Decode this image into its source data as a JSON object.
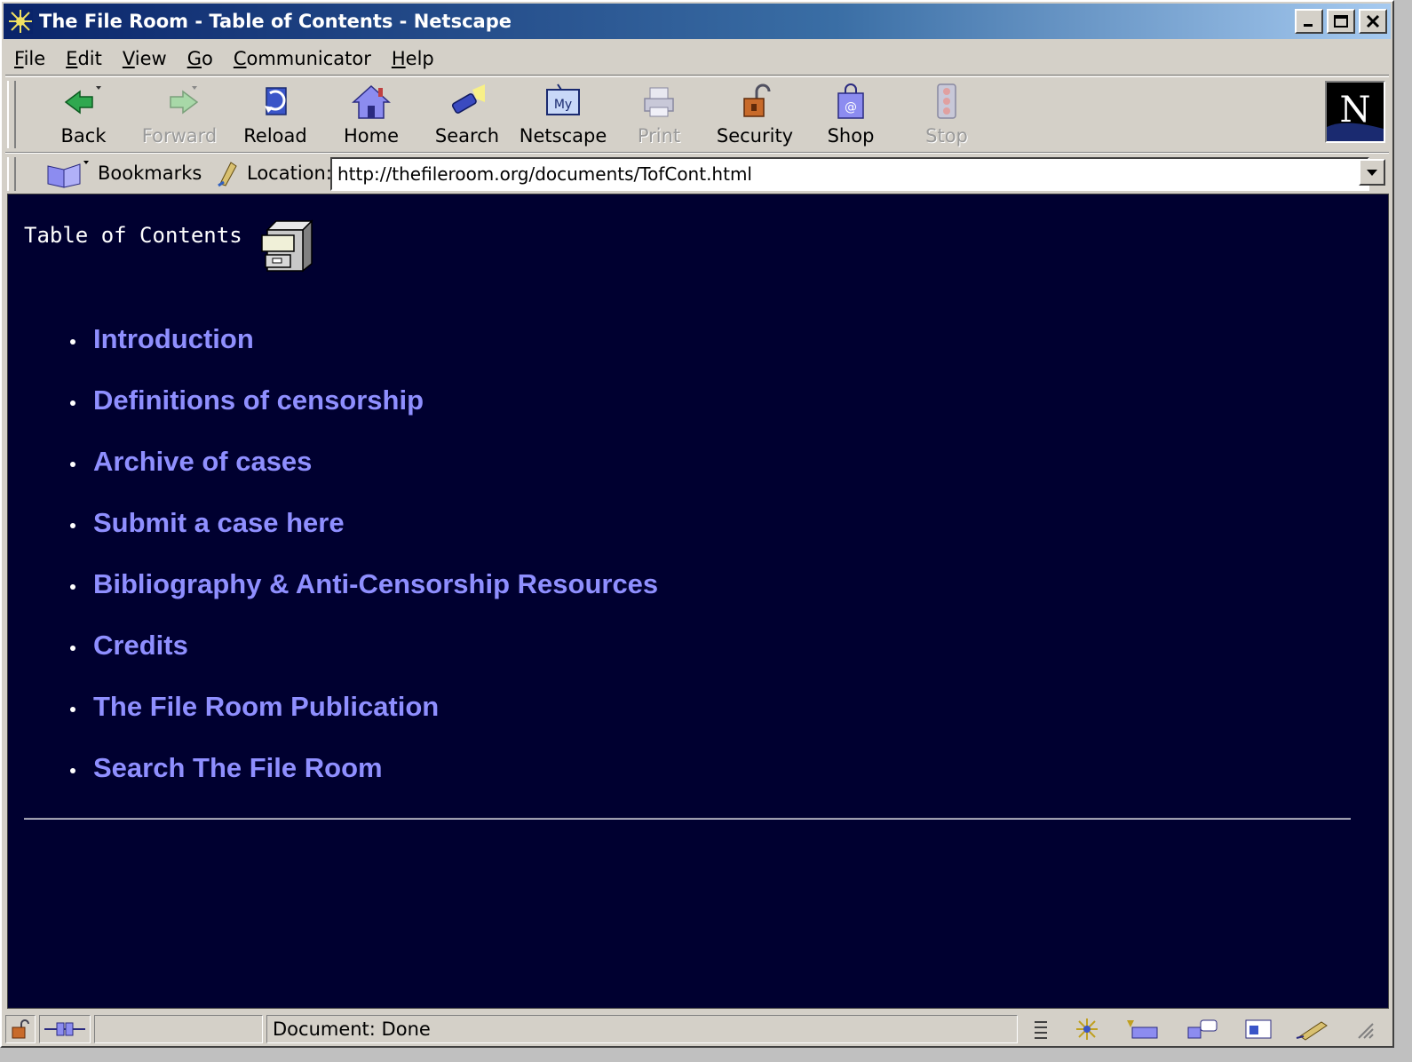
{
  "window": {
    "title": "The File Room - Table of Contents - Netscape"
  },
  "menubar": {
    "items": [
      {
        "accel": "F",
        "rest": "ile"
      },
      {
        "accel": "E",
        "rest": "dit"
      },
      {
        "accel": "V",
        "rest": "iew"
      },
      {
        "accel": "G",
        "rest": "o"
      },
      {
        "accel": "C",
        "rest": "ommunicator"
      },
      {
        "accel": "H",
        "rest": "elp"
      }
    ]
  },
  "toolbar": {
    "back": "Back",
    "forward": "Forward",
    "reload": "Reload",
    "home": "Home",
    "search": "Search",
    "netscape": "Netscape",
    "print": "Print",
    "security": "Security",
    "shop": "Shop",
    "stop": "Stop"
  },
  "locationbar": {
    "bookmarks": "Bookmarks",
    "location_label": "Location:",
    "url": "http://thefileroom.org/documents/TofCont.html"
  },
  "page": {
    "heading": "Table of Contents",
    "links": [
      "Introduction",
      "Definitions of censorship",
      "Archive of cases",
      "Submit a case here",
      "Bibliography & Anti-Censorship Resources",
      "Credits",
      "The File Room Publication",
      "Search The File Room"
    ],
    "background_color": "#000030",
    "link_color": "#8f8fff"
  },
  "statusbar": {
    "text": "Document: Done"
  }
}
